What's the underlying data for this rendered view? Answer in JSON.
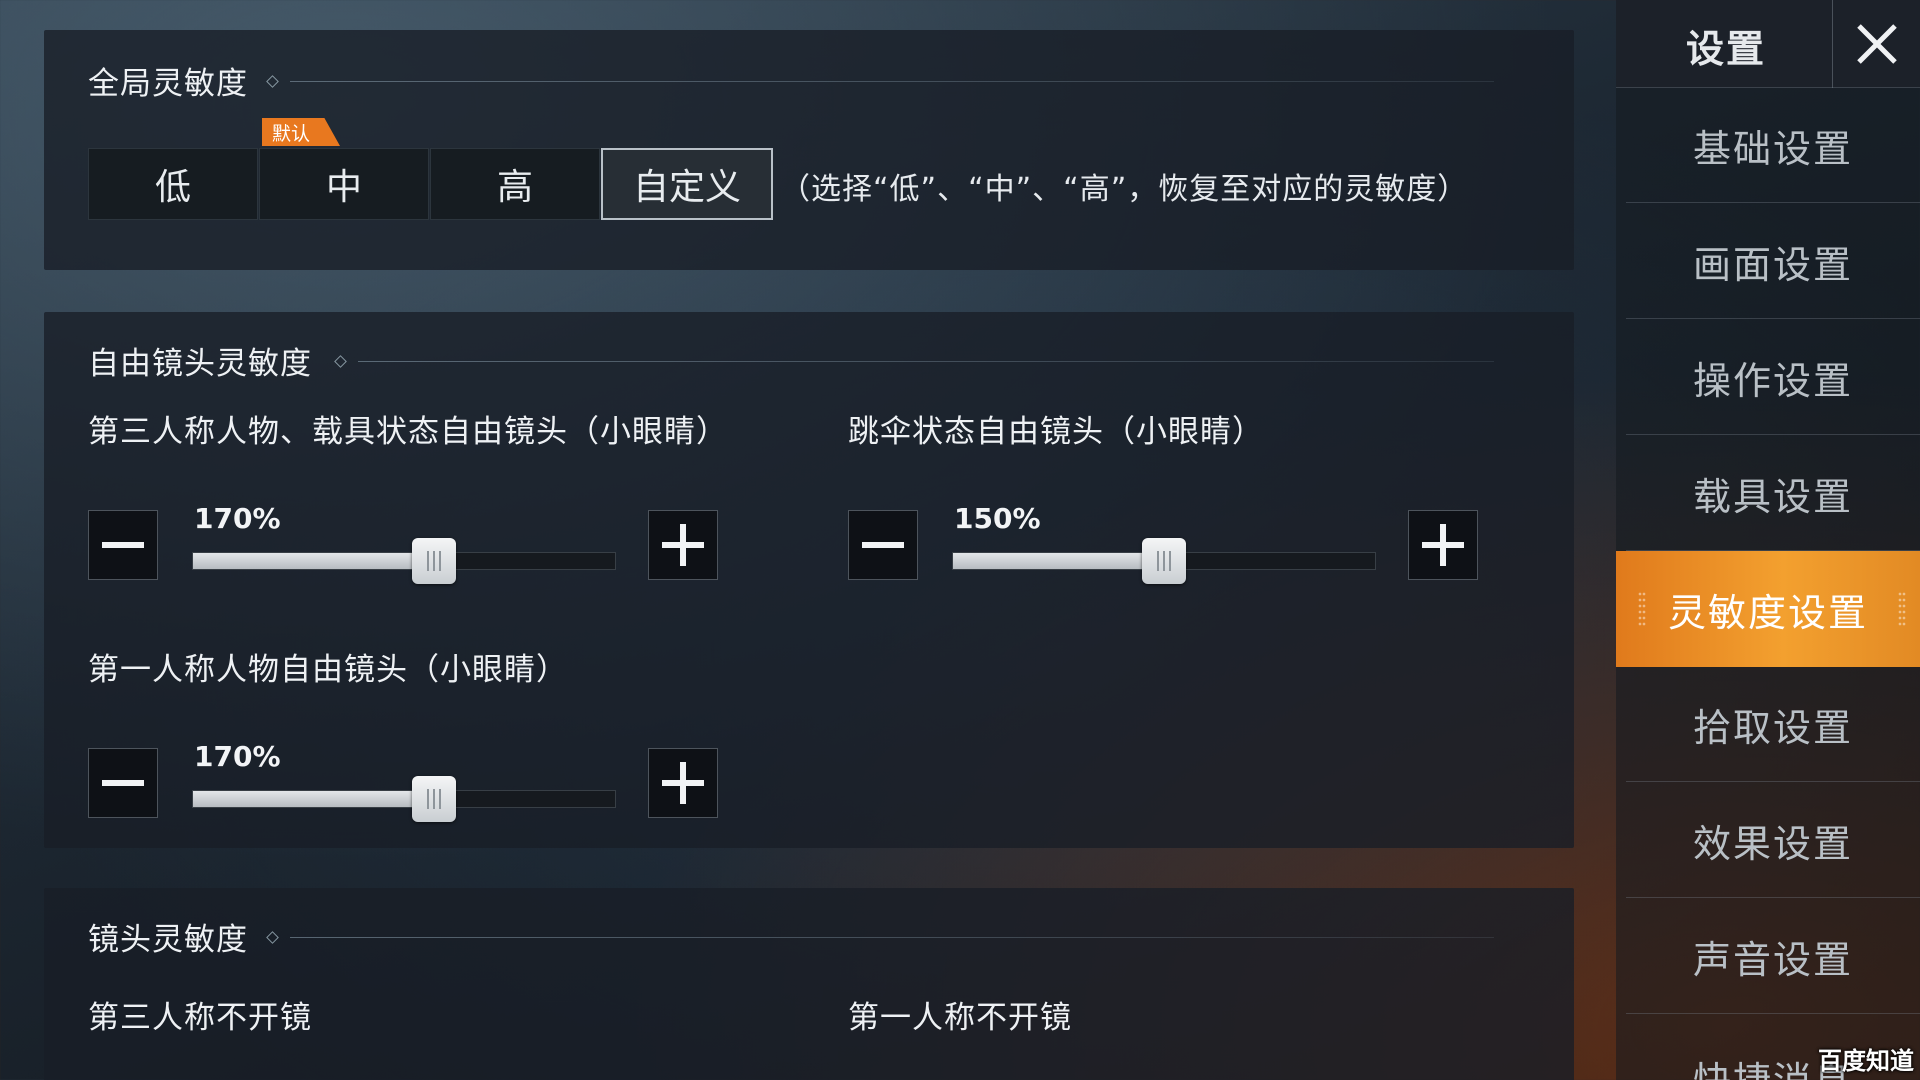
{
  "global_sensitivity": {
    "title": "全局灵敏度",
    "default_tag": "默认",
    "levels": [
      {
        "label": "低",
        "selected": false
      },
      {
        "label": "中",
        "selected": false
      },
      {
        "label": "高",
        "selected": false
      },
      {
        "label": "自定义",
        "selected": true
      }
    ],
    "hint": "（选择“低”、“中”、“高”，恢复至对应的灵敏度）"
  },
  "free_camera": {
    "title": "自由镜头灵敏度",
    "sliders": [
      {
        "label": "第三人称人物、载具状态自由镜头（小眼睛）",
        "value_text": "170%",
        "fraction": 0.57
      },
      {
        "label": "跳伞状态自由镜头（小眼睛）",
        "value_text": "150%",
        "fraction": 0.5
      },
      {
        "label": "第一人称人物自由镜头（小眼睛）",
        "value_text": "170%",
        "fraction": 0.57
      }
    ]
  },
  "camera_sensitivity": {
    "title": "镜头灵敏度",
    "items": [
      "第三人称不开镜",
      "第一人称不开镜"
    ]
  },
  "sidebar": {
    "title": "设置",
    "close_icon": "close-icon",
    "items": [
      {
        "label": "基础设置",
        "active": false
      },
      {
        "label": "画面设置",
        "active": false
      },
      {
        "label": "操作设置",
        "active": false
      },
      {
        "label": "载具设置",
        "active": false
      },
      {
        "label": "灵敏度设置",
        "active": true
      },
      {
        "label": "拾取设置",
        "active": false
      },
      {
        "label": "效果设置",
        "active": false
      },
      {
        "label": "声音设置",
        "active": false
      },
      {
        "label": "快捷消息",
        "active": false
      }
    ]
  },
  "watermark": "百度知道",
  "colors": {
    "accent": "#f39a2c",
    "default_tag": "#e8781f",
    "panel": "#181e26"
  }
}
